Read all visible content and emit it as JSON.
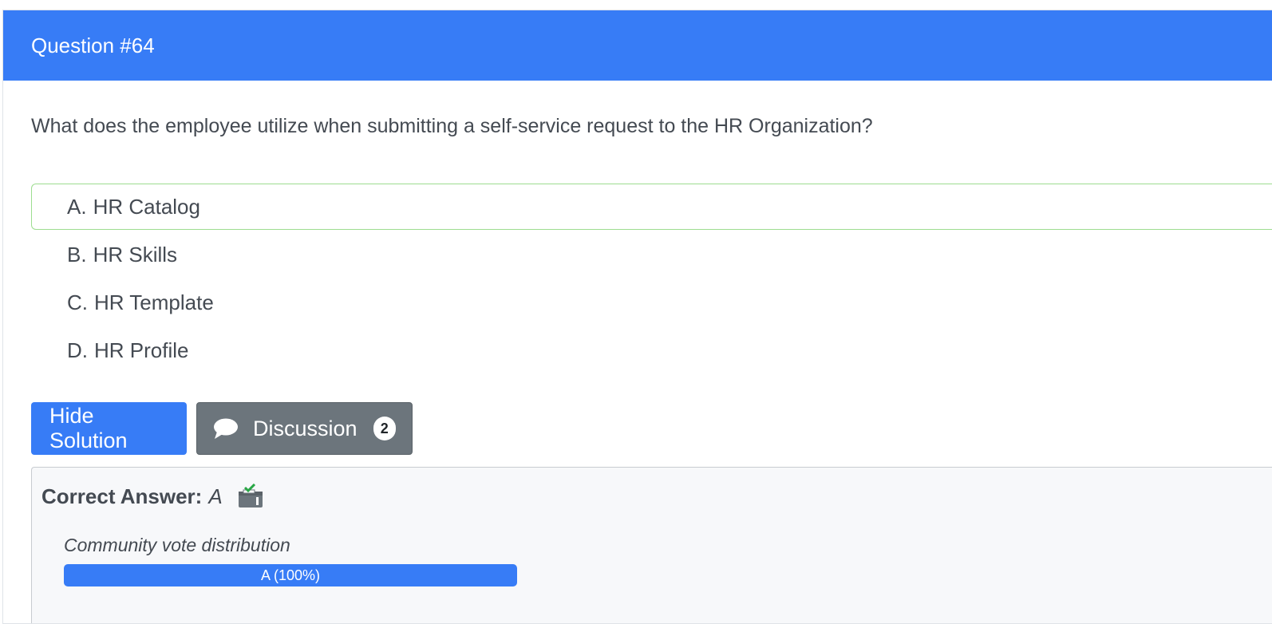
{
  "header": {
    "title": "Question #64"
  },
  "question": {
    "text": "What does the employee utilize when submitting a self-service request to the HR Organization?"
  },
  "choices": [
    {
      "letter": "A.",
      "text": "HR Catalog",
      "correct": true
    },
    {
      "letter": "B.",
      "text": "HR Skills",
      "correct": false
    },
    {
      "letter": "C.",
      "text": "HR Template",
      "correct": false
    },
    {
      "letter": "D.",
      "text": "HR Profile",
      "correct": false
    }
  ],
  "buttons": {
    "hide_solution": "Hide Solution",
    "discussion": "Discussion",
    "discussion_count": "2"
  },
  "answer": {
    "label": "Correct Answer:",
    "value": "A",
    "vote_title": "Community vote distribution",
    "vote_bar_label": "A (100%)",
    "vote_fraction": 1.0
  },
  "colors": {
    "primary": "#377cf6",
    "secondary": "#6c757c",
    "correct_border": "#9ddd90"
  },
  "icons": {
    "discussion": "comment-icon",
    "reveal": "ballot-box-check-icon"
  }
}
